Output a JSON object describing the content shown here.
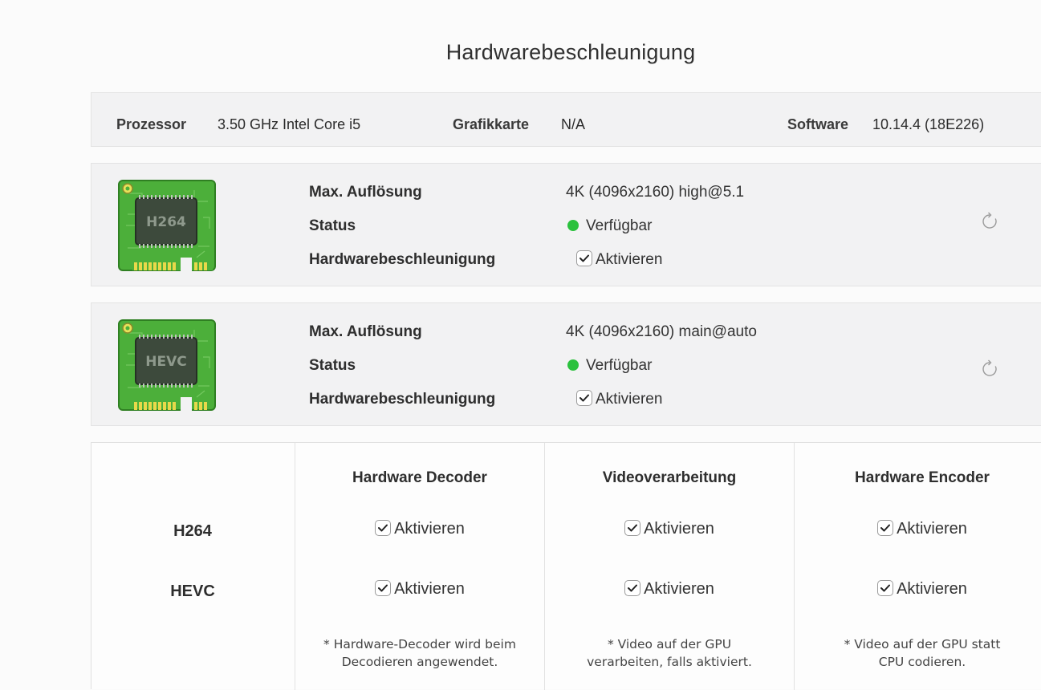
{
  "page": {
    "title": "Hardwarebeschleunigung"
  },
  "info": {
    "processor_label": "Prozessor",
    "processor_value": "3.50 GHz Intel Core i5",
    "gpu_label": "Grafikkarte",
    "gpu_value": "N/A",
    "software_label": "Software",
    "software_value": "10.14.4 (18E226)"
  },
  "codecs": [
    {
      "chip_label": "H264",
      "resolution_label": "Max. Auflösung",
      "resolution_value": "4K (4096x2160) high@5.1",
      "status_label": "Status",
      "status_value": "Verfügbar",
      "accel_label": "Hardwarebeschleunigung",
      "accel_checkbox": "Aktivieren",
      "accel_checked": true,
      "refresh_icon": "refresh-icon"
    },
    {
      "chip_label": "HEVC",
      "resolution_label": "Max. Auflösung",
      "resolution_value": "4K (4096x2160) main@auto",
      "status_label": "Status",
      "status_value": "Verfügbar",
      "accel_label": "Hardwarebeschleunigung",
      "accel_checkbox": "Aktivieren",
      "accel_checked": true,
      "refresh_icon": "refresh-icon"
    }
  ],
  "matrix": {
    "columns": [
      "Hardware Decoder",
      "Videoverarbeitung",
      "Hardware Encoder"
    ],
    "rows": [
      {
        "label": "H264",
        "cells": [
          "Aktivieren",
          "Aktivieren",
          "Aktivieren"
        ]
      },
      {
        "label": "HEVC",
        "cells": [
          "Aktivieren",
          "Aktivieren",
          "Aktivieren"
        ]
      }
    ],
    "notes": [
      [
        "* Hardware-Decoder wird beim",
        "Decodieren angewendet."
      ],
      [
        "* Video auf der GPU",
        "verarbeiten, falls aktiviert."
      ],
      [
        "* Video auf der GPU statt",
        "CPU codieren."
      ]
    ]
  },
  "colors": {
    "status_available": "#2bc13d",
    "chip_green": "#4caf3a",
    "chip_die": "#3d4a3c"
  }
}
